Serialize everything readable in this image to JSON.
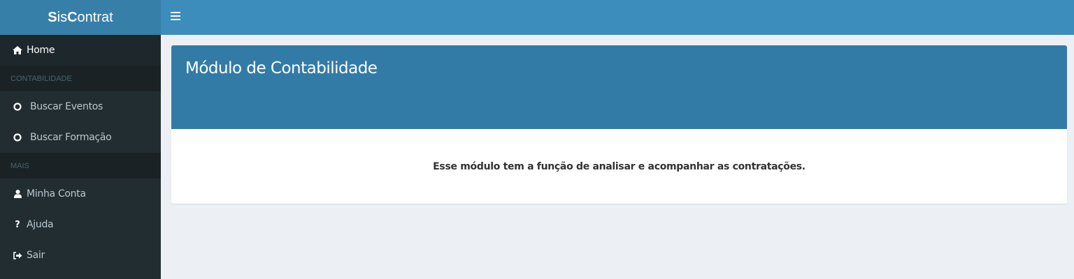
{
  "app": {
    "logo_prefix": "S",
    "logo_mid": "is",
    "logo_c": "C",
    "logo_suffix": "ontrat"
  },
  "sidebar": {
    "home_label": "Home",
    "section_contabilidade": "CONTABILIDADE",
    "buscar_eventos_label": "Buscar Eventos",
    "buscar_formacao_label": "Buscar Formação",
    "section_mais": "MAIS",
    "minha_conta_label": "Minha Conta",
    "ajuda_label": "Ajuda",
    "sair_label": "Sair"
  },
  "main": {
    "title": "Módulo de Contabilidade",
    "description": "Esse módulo tem a função de analisar e acompanhar as contratações."
  },
  "colors": {
    "topbar": "#3c8dbc",
    "logo_bg": "#367fa9",
    "sidebar_bg": "#222d32",
    "box_header": "#337ba7",
    "page_bg": "#ecf0f5"
  }
}
